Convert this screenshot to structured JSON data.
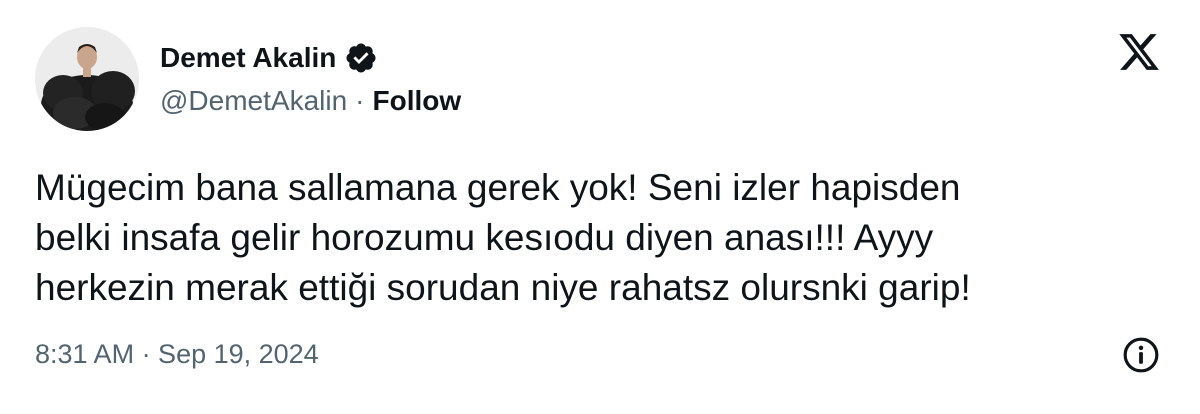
{
  "author": {
    "display_name": "Demet Akalin",
    "handle": "@DemetAkalin",
    "separator": "·",
    "follow_label": "Follow",
    "verified_icon": "verified-badge-icon",
    "avatar_icon": "profile-photo"
  },
  "brand": {
    "logo_icon": "x-logo-icon"
  },
  "tweet": {
    "lines": [
      "Mügecim bana sallamana gerek yok! Seni izler hapisden",
      "belki insafa gelir horozumu kesıodu diyen anası!!! Ayyy",
      "herkezin merak ettiği sorudan niye rahatsz olursnki garip!"
    ]
  },
  "meta": {
    "timestamp": "8:31 AM · Sep 19, 2024",
    "info_icon": "info-icon"
  },
  "colors": {
    "text_primary": "#0f1419",
    "text_secondary": "#536471",
    "background": "#ffffff"
  }
}
